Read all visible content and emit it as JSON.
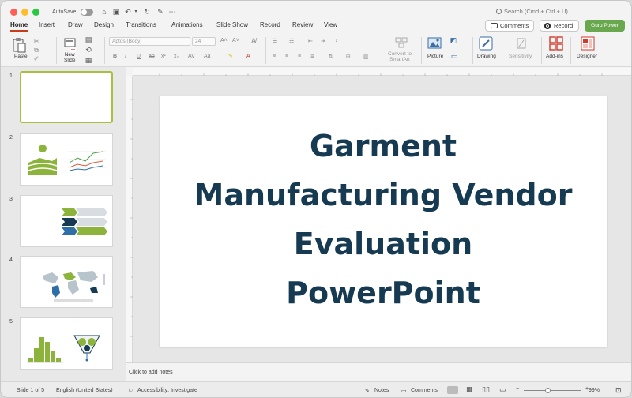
{
  "titlebar": {
    "autosave_label": "AutoSave",
    "search_placeholder": "Search (Cmd + Ctrl + U)"
  },
  "tabs": [
    {
      "label": "Home",
      "active": true
    },
    {
      "label": "Insert"
    },
    {
      "label": "Draw"
    },
    {
      "label": "Design"
    },
    {
      "label": "Transitions"
    },
    {
      "label": "Animations"
    },
    {
      "label": "Slide Show"
    },
    {
      "label": "Record"
    },
    {
      "label": "Review"
    },
    {
      "label": "View"
    }
  ],
  "header_buttons": {
    "comments": "Comments",
    "record": "Record",
    "guru": "Guru Power"
  },
  "ribbon": {
    "paste": "Paste",
    "new_slide_1": "New",
    "new_slide_2": "Slide",
    "font_name": "Aptos (Body)",
    "font_size": "24",
    "convert_1": "Convert to",
    "convert_2": "SmartArt",
    "picture": "Picture",
    "drawing": "Drawing",
    "sensitivity": "Sensitivity",
    "addins": "Add-ins",
    "designer": "Designer"
  },
  "slides": [
    {
      "num": "1"
    },
    {
      "num": "2"
    },
    {
      "num": "3"
    },
    {
      "num": "4"
    },
    {
      "num": "5"
    }
  ],
  "slide": {
    "title_line1": "Garment",
    "title_line2": "Manufacturing Vendor",
    "title_line3": "Evaluation",
    "title_line4": "PowerPoint",
    "title_color": "#163a52"
  },
  "notes_placeholder": "Click to add notes",
  "status": {
    "slide_count": "Slide 1 of 5",
    "language": "English (United States)",
    "accessibility": "Accessibility: Investigate",
    "notes": "Notes",
    "comments": "Comments",
    "zoom": "99%"
  },
  "colors": {
    "accent_green": "#8cb43c",
    "accent_navy": "#163a52",
    "active_tab": "#c43e1c"
  }
}
